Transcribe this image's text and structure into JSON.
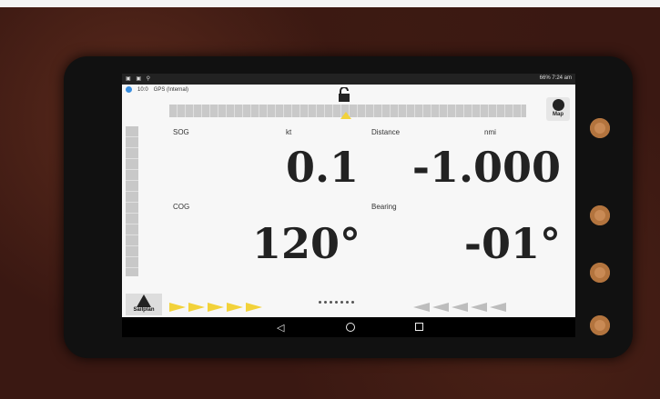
{
  "status_bar": {
    "left_icons": "▣ ▣ ⚲",
    "right": "66% 7:24 am"
  },
  "app": {
    "time": "10:0",
    "source": "GPS (Internal)",
    "map_button": "Map",
    "sog": {
      "label": "SOG",
      "unit": "kt",
      "value": "0.1"
    },
    "distance": {
      "label": "Distance",
      "unit": "nmi",
      "value": "-1.000"
    },
    "cog": {
      "label": "COG",
      "value": "120°"
    },
    "bearing": {
      "label": "Bearing",
      "value": "-01°"
    },
    "sailplan_label": "Sailplan"
  },
  "colors": {
    "arrow_yellow": "#f2d23a",
    "arrow_grey": "#bdbdbd",
    "bezel": "#111111",
    "button_copper": "#c98a55"
  }
}
